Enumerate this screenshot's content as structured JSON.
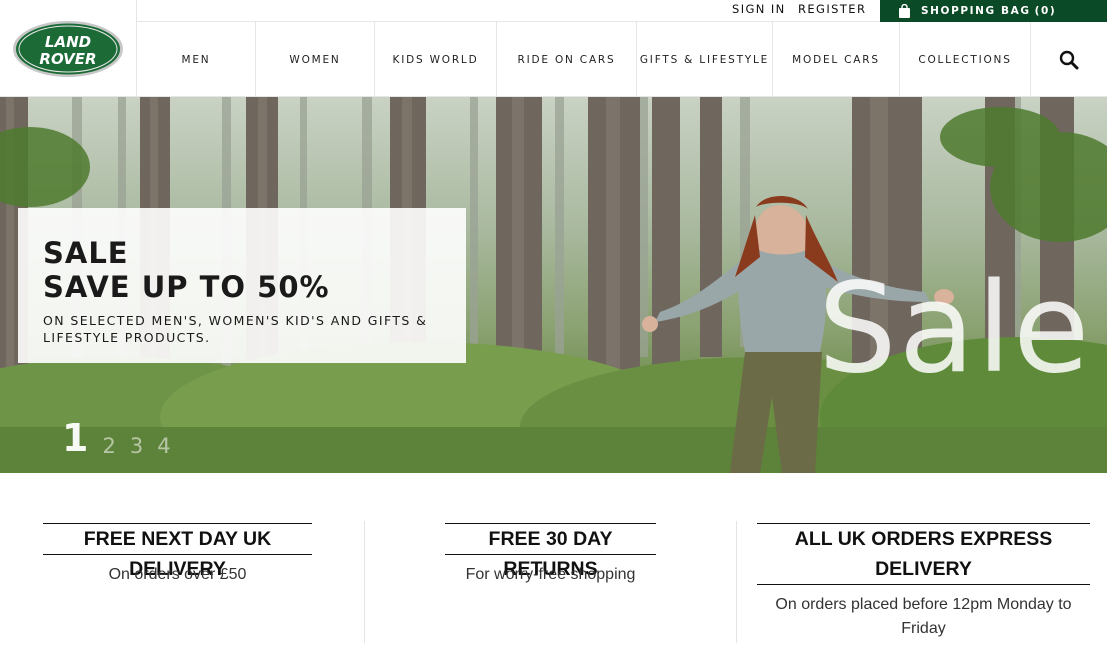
{
  "brand": {
    "logo_line1": "LAND",
    "logo_line2": "ROVER"
  },
  "utility": {
    "sign_in": "SIGN IN",
    "register": "REGISTER",
    "bag_label": "SHOPPING BAG",
    "bag_count": "(0)"
  },
  "nav": {
    "items": [
      {
        "label": "MEN"
      },
      {
        "label": "WOMEN"
      },
      {
        "label": "KIDS WORLD"
      },
      {
        "label": "RIDE ON CARS"
      },
      {
        "label": "GIFTS & LIFESTYLE"
      },
      {
        "label": "MODEL CARS"
      },
      {
        "label": "COLLECTIONS"
      }
    ],
    "search_icon": "search-icon"
  },
  "hero": {
    "title_line1": "SALE",
    "title_line2": "SAVE UP TO 50%",
    "subtitle": "ON SELECTED MEN'S, WOMEN'S KID'S AND GIFTS & LIFESTYLE PRODUCTS.",
    "overlay_word": "Sale",
    "slides": [
      "1",
      "2",
      "3",
      "4"
    ],
    "active_slide": "1"
  },
  "benefits": [
    {
      "title": "FREE NEXT DAY UK DELIVERY",
      "text": "On orders over £50"
    },
    {
      "title": "FREE 30 DAY RETURNS",
      "text": "For worry-free shopping"
    },
    {
      "title_line1": "ALL UK ORDERS EXPRESS",
      "title_line2": "DELIVERY",
      "text_line1": "On orders placed before 12pm Monday to",
      "text_line2": "Friday"
    }
  ],
  "colors": {
    "brand_green": "#0b4a26",
    "text": "#111111",
    "border": "#e6e6e6"
  }
}
